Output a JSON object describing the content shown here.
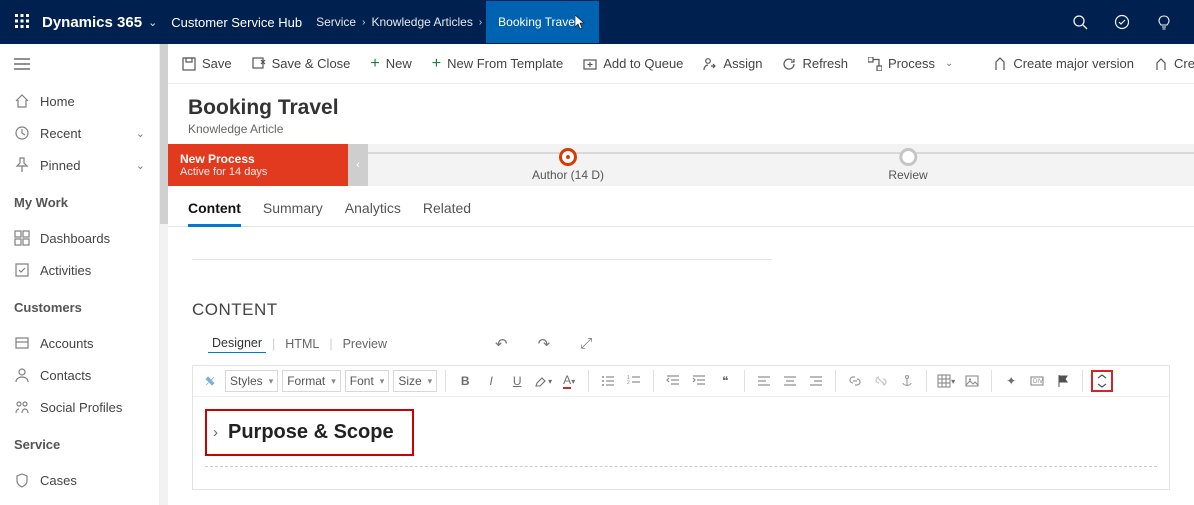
{
  "top_nav": {
    "brand": "Dynamics 365",
    "module": "Customer Service Hub",
    "breadcrumbs": [
      "Service",
      "Knowledge Articles",
      "Booking Travel"
    ]
  },
  "sidebar": {
    "items": [
      {
        "label": "Home"
      },
      {
        "label": "Recent",
        "expandable": true
      },
      {
        "label": "Pinned",
        "expandable": true
      }
    ],
    "sections": [
      {
        "title": "My Work",
        "items": [
          "Dashboards",
          "Activities"
        ]
      },
      {
        "title": "Customers",
        "items": [
          "Accounts",
          "Contacts",
          "Social Profiles"
        ]
      },
      {
        "title": "Service",
        "items": [
          "Cases"
        ]
      }
    ]
  },
  "commands": {
    "save": "Save",
    "save_close": "Save & Close",
    "new": "New",
    "new_from_template": "New From Template",
    "add_to_queue": "Add to Queue",
    "assign": "Assign",
    "refresh": "Refresh",
    "process": "Process",
    "create_major": "Create major version",
    "create_minor": "Create minor "
  },
  "record": {
    "title": "Booking Travel",
    "subtitle": "Knowledge Article"
  },
  "process": {
    "name": "New Process",
    "status": "Active for 14 days",
    "stages": [
      {
        "label": "Author  (14 D)",
        "active": true
      },
      {
        "label": "Review",
        "active": false
      }
    ]
  },
  "tabs": [
    "Content",
    "Summary",
    "Analytics",
    "Related"
  ],
  "content": {
    "section": "CONTENT",
    "editor_tabs": [
      "Designer",
      "HTML",
      "Preview"
    ],
    "toolbar_selects": {
      "styles": "Styles",
      "format": "Format",
      "font": "Font",
      "size": "Size"
    },
    "heading": "Purpose & Scope"
  }
}
